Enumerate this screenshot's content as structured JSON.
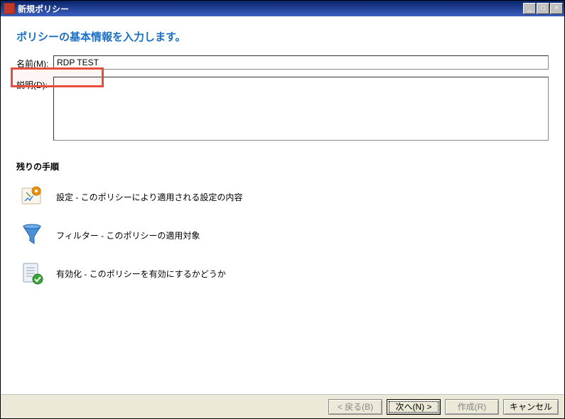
{
  "titlebar": {
    "title": "新規ポリシー",
    "minimize": "_",
    "maximize": "□",
    "close": "×"
  },
  "heading": "ポリシーの基本情報を入力します。",
  "form": {
    "name_label": "名前(M):",
    "name_value": "RDP TEST",
    "desc_label": "説明(D):",
    "desc_value": ""
  },
  "steps": {
    "title": "残りの手順",
    "items": [
      {
        "text": "設定 - このポリシーにより適用される設定の内容"
      },
      {
        "text": "フィルター - このポリシーの適用対象"
      },
      {
        "text": "有効化 - このポリシーを有効にするかどうか"
      }
    ]
  },
  "buttons": {
    "back": "< 戻る(B)",
    "next": "次へ(N) >",
    "create": "作成(R)",
    "cancel": "キャンセル"
  }
}
